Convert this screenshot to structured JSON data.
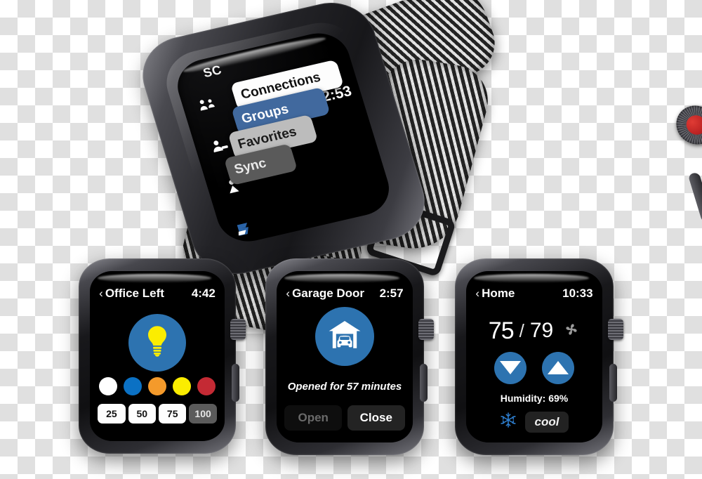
{
  "background": {
    "style": "transparency-checkerboard",
    "light": "#ffffff",
    "dark": "#e0e0e0"
  },
  "accent": {
    "blue": "#2d73b0",
    "menu_blue": "#41699e",
    "red_crown": "#cc2229"
  },
  "watches": {
    "top": {
      "app_initials": "SC",
      "clock": "2:53",
      "icons": [
        {
          "name": "connections-icon"
        },
        {
          "name": "groups-icon"
        },
        {
          "name": "favorites-person-icon"
        },
        {
          "name": "savant-s-logo-icon"
        }
      ],
      "menu": [
        {
          "label": "Connections",
          "style": "white"
        },
        {
          "label": "Groups",
          "style": "blue"
        },
        {
          "label": "Favorites",
          "style": "grey"
        },
        {
          "label": "Sync",
          "style": "dark"
        }
      ]
    },
    "light": {
      "back_chevron": "‹",
      "title": "Office Left",
      "clock": "4:42",
      "device_icon": "lightbulb-icon",
      "swatches": [
        {
          "name": "white",
          "hex": "#ffffff"
        },
        {
          "name": "blue",
          "hex": "#0b71c4"
        },
        {
          "name": "orange",
          "hex": "#f49a2b"
        },
        {
          "name": "yellow",
          "hex": "#fbed00"
        },
        {
          "name": "red",
          "hex": "#c42a34"
        }
      ],
      "levels": [
        {
          "label": "25",
          "active": false
        },
        {
          "label": "50",
          "active": false
        },
        {
          "label": "75",
          "active": false
        },
        {
          "label": "100",
          "active": true
        }
      ]
    },
    "garage": {
      "back_chevron": "‹",
      "title": "Garage Door",
      "clock": "2:57",
      "device_icon": "garage-door-car-icon",
      "status": "Opened for 57 minutes",
      "buttons": [
        {
          "label": "Open",
          "state": "disabled"
        },
        {
          "label": "Close",
          "state": "enabled"
        }
      ]
    },
    "thermostat": {
      "back_chevron": "‹",
      "title": "Home",
      "clock": "10:33",
      "current_temp": "75",
      "separator": "/",
      "target_temp": "79",
      "fan_icon": "fan-icon",
      "down_button": "decrease-temp-button",
      "up_button": "increase-temp-button",
      "humidity": "Humidity: 69%",
      "mode_icon": "snowflake-icon",
      "mode_label": "cool"
    }
  }
}
